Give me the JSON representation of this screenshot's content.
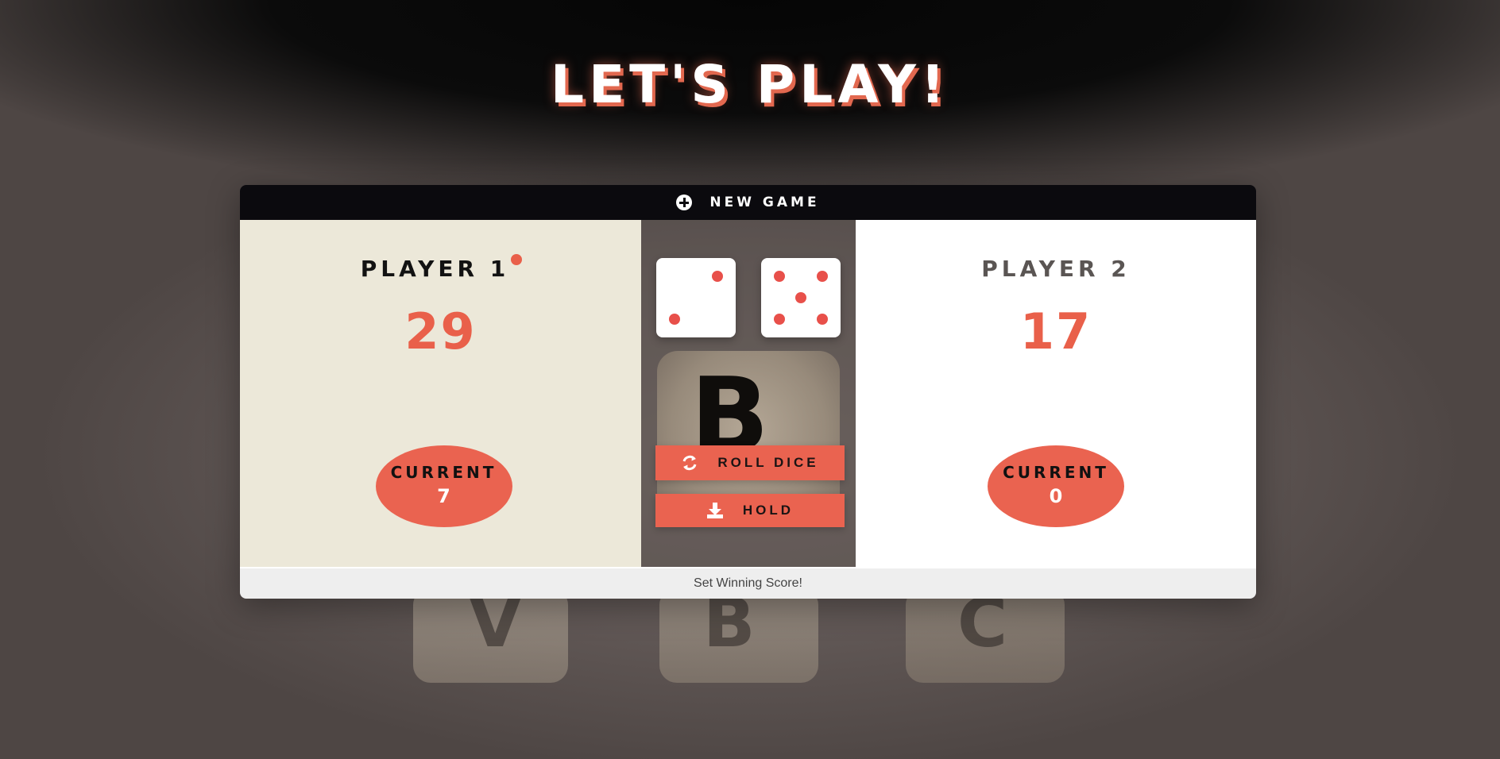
{
  "title": "LET'S PLAY!",
  "toolbar": {
    "new_game_label": "NEW GAME",
    "new_game_icon": "plus-circle-icon"
  },
  "players": [
    {
      "name": "PLAYER 1",
      "score": "29",
      "current_label": "CURRENT",
      "current_value": "7",
      "active": true
    },
    {
      "name": "PLAYER 2",
      "score": "17",
      "current_label": "CURRENT",
      "current_value": "0",
      "active": false
    }
  ],
  "dice": [
    2,
    5
  ],
  "actions": {
    "roll_label": "ROLL DICE",
    "roll_icon": "refresh-icon",
    "hold_label": "HOLD",
    "hold_icon": "download-icon"
  },
  "footer": {
    "winning_score_label": "Set Winning Score!"
  },
  "background_letters": [
    "B",
    "V",
    "B",
    "C"
  ],
  "colors": {
    "accent": "#ea6350",
    "topbar": "#0b0a0e",
    "player1_bg": "#ece8d9",
    "player2_bg": "#ffffff"
  }
}
